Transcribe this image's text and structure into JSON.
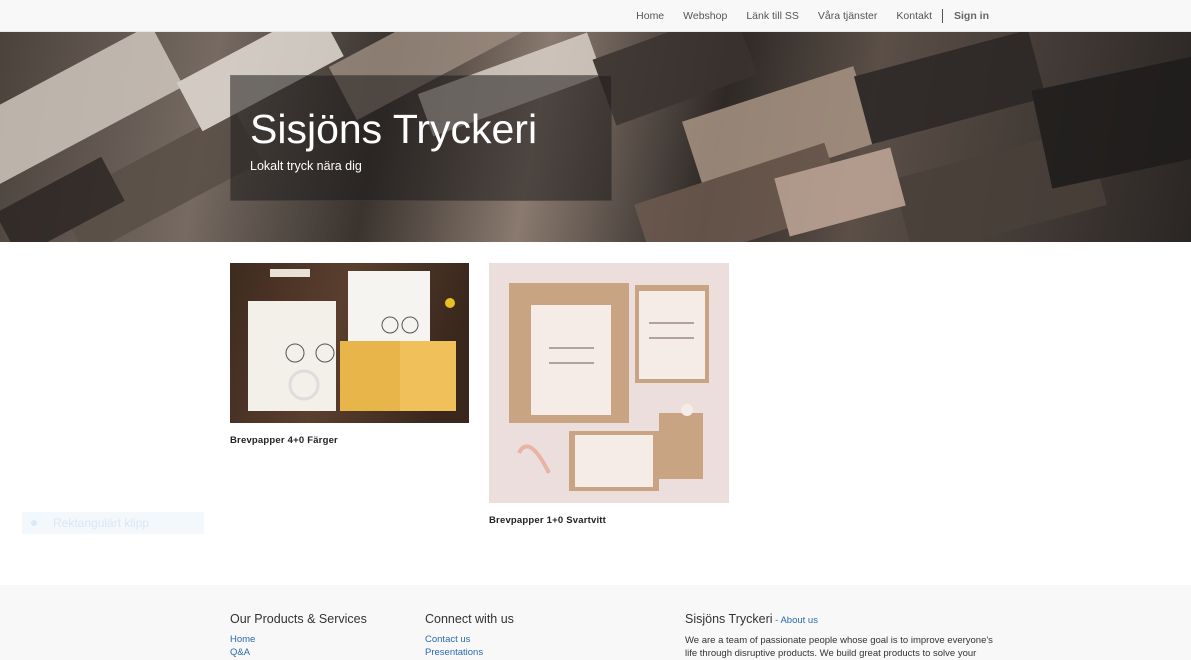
{
  "nav": {
    "items": [
      "Home",
      "Webshop",
      "Länk till SS",
      "Våra tjänster",
      "Kontakt"
    ],
    "signin": "Sign in"
  },
  "hero": {
    "title": "Sisjöns Tryckeri",
    "subtitle": "Lokalt tryck nära dig"
  },
  "products": [
    {
      "name": "Brevpapper 4+0 Färger"
    },
    {
      "name": "Brevpapper 1+0 Svartvitt"
    }
  ],
  "ghost_label": "Rektangulärt klipp",
  "footer": {
    "col1": {
      "heading": "Our Products & Services",
      "links": [
        "Home",
        "Q&A"
      ]
    },
    "col2": {
      "heading": "Connect with us",
      "links": [
        "Contact us",
        "Presentations"
      ]
    },
    "col3": {
      "heading": "Sisjöns Tryckeri",
      "separator": " - ",
      "about_link": "About us",
      "text": "We are a team of passionate people whose goal is to improve everyone's life through disruptive products. We build great products to solve your"
    }
  },
  "colors": {
    "link": "#2a6aad",
    "footer_bg": "#f8f8f8",
    "topbar_bg": "#f8f8f8"
  }
}
